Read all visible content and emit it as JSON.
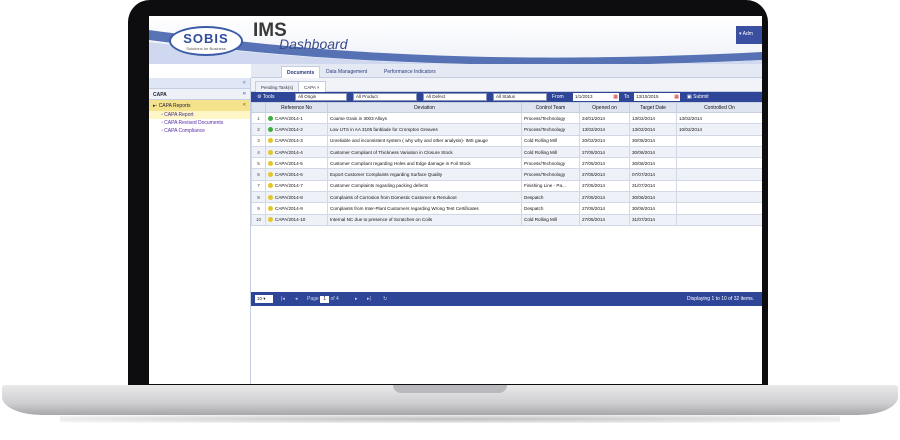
{
  "header": {
    "logo_main": "SOBIS",
    "logo_sub": "Solutions for Business",
    "title": "IMS",
    "subtitle": "Dashboard",
    "user_label": "Adm"
  },
  "nav": {
    "tabs": [
      "Documents",
      "Data Management",
      "Performance Indicators"
    ]
  },
  "sidebar": {
    "top_chevron": "«",
    "section": "CAPA",
    "section_chevron": "»",
    "category": "CAPA Reports",
    "category_chevron": "«",
    "links": [
      "CAPA Report",
      "CAPA Revised Documents",
      "CAPA Compliance"
    ]
  },
  "subtabs": [
    "Pending Task(s)",
    "CAPA ×"
  ],
  "toolbar": {
    "tools_label": "Tools",
    "origin": "All Origin",
    "product": "All Product",
    "defect": "All Defect",
    "status": "All Status",
    "from_label": "From",
    "from_date": "1/1/2013",
    "to_label": "To",
    "to_date": "13/10/2015",
    "submit_label": "Submit"
  },
  "table": {
    "columns": [
      "",
      "Reference No",
      "Deviation",
      "Control Team",
      "Opened on",
      "Target Date",
      "Controlled On"
    ],
    "rows": [
      {
        "n": "1",
        "status": "green",
        "ref": "CAPA/2014-1",
        "dev": "Coarse Grain in 3003 Alloys",
        "team": "Process/Technology",
        "opened": "24/01/2014",
        "target": "13/02/2014",
        "controlled": "13/02/2014"
      },
      {
        "n": "2",
        "status": "green",
        "ref": "CAPA/2014-2",
        "dev": "Low UTS in AA 3105 fanblade for Crompton Greaves",
        "team": "Process/Technology",
        "opened": "13/02/2014",
        "target": "13/02/2014",
        "controlled": "10/02/2014"
      },
      {
        "n": "3",
        "status": "yellow",
        "ref": "CAPA/2014-3",
        "dev": "Unreliable and inconsistent system ( why why and other analysis)- IMS gauge",
        "team": "Cold Rolling Mill",
        "opened": "20/02/2014",
        "target": "30/05/2014",
        "controlled": ""
      },
      {
        "n": "4",
        "status": "yellow",
        "ref": "CAPA/2014-4",
        "dev": "Customer Compliant of Thickness Variation in Closure Stock",
        "team": "Cold Rolling Mill",
        "opened": "27/05/2014",
        "target": "30/06/2014",
        "controlled": ""
      },
      {
        "n": "5",
        "status": "yellow",
        "ref": "CAPA/2014-5",
        "dev": "Customer Compliant regarding Holes and Edge damage in Foil Stock",
        "team": "Process/Technology",
        "opened": "27/05/2014",
        "target": "30/06/2014",
        "controlled": ""
      },
      {
        "n": "6",
        "status": "yellow",
        "ref": "CAPA/2014-6",
        "dev": "Export Customer Complaints regarding Surface Quality",
        "team": "Process/Technology",
        "opened": "27/05/2014",
        "target": "07/07/2014",
        "controlled": ""
      },
      {
        "n": "7",
        "status": "yellow",
        "ref": "CAPA/2014-7",
        "dev": "Customer Complaints regarding packing defects",
        "team": "Finishing Line - Pa...",
        "opened": "27/05/2014",
        "target": "31/07/2014",
        "controlled": ""
      },
      {
        "n": "8",
        "status": "yellow",
        "ref": "CAPA/2014-8",
        "dev": "Complaints of Corrosion from Domestic Customer & Renukoot",
        "team": "Despatch",
        "opened": "27/05/2014",
        "target": "30/06/2014",
        "controlled": ""
      },
      {
        "n": "9",
        "status": "yellow",
        "ref": "CAPA/2014-9",
        "dev": "Complaints from Inter-Plant Customers regarding Wrong Test Certificates",
        "team": "Despatch",
        "opened": "27/05/2014",
        "target": "30/06/2014",
        "controlled": ""
      },
      {
        "n": "10",
        "status": "yellow",
        "ref": "CAPA/2014-10",
        "dev": "Internal NC due to presence of Scratches on Coils",
        "team": "Cold Rolling Mill",
        "opened": "27/05/2014",
        "target": "31/07/2014",
        "controlled": ""
      }
    ]
  },
  "pager": {
    "page_size": "10",
    "page_label": "Page",
    "page_value": "1",
    "of_label": "of 4",
    "info": "Displaying 1 to 10 of 32 items."
  },
  "colors": {
    "accent": "#2f4598",
    "status_green": "#3fae3f",
    "status_yellow": "#e3c62e"
  }
}
